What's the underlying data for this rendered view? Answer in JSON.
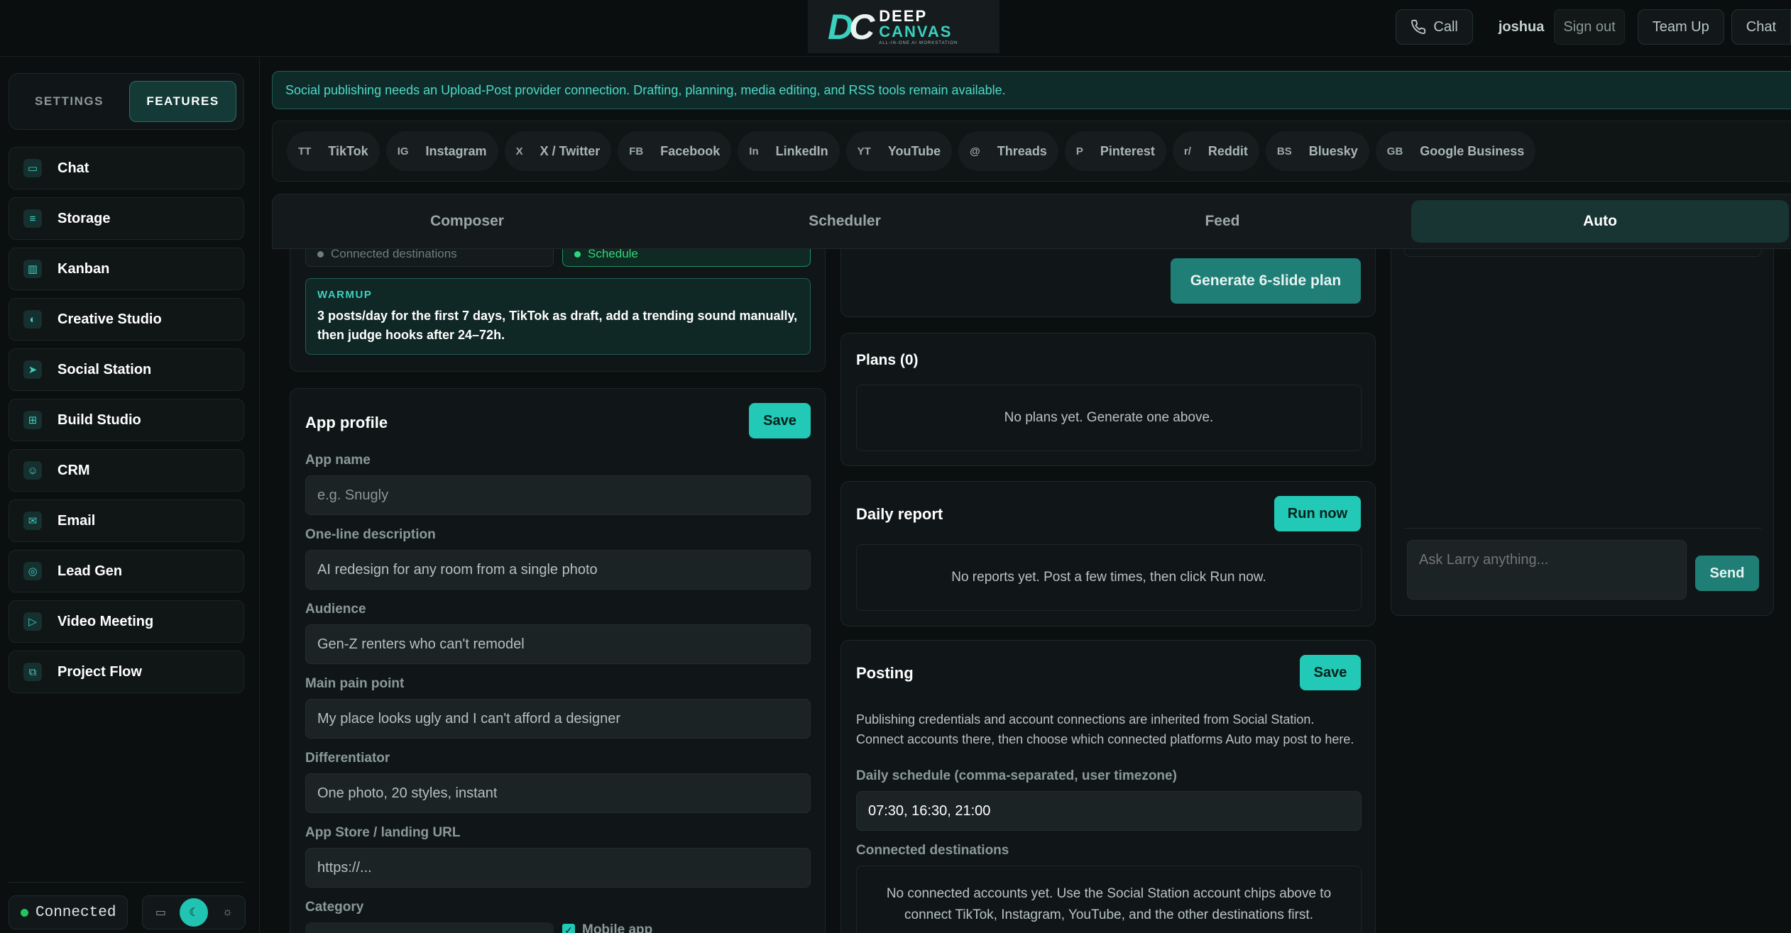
{
  "header": {
    "logo_mark": "DC",
    "logo_line1": "DEEP",
    "logo_line2": "CANVAS",
    "logo_tagline": "ALL-IN-ONE AI WORKSTATION",
    "call_label": "Call",
    "username": "joshua",
    "signout_label": "Sign out",
    "teamup_label": "Team Up",
    "chat_label": "Chat"
  },
  "sidebar": {
    "tabs": [
      "SETTINGS",
      "FEATURES"
    ],
    "active_tab": "FEATURES",
    "items": [
      {
        "label": "Chat",
        "icon": "chat-icon"
      },
      {
        "label": "Storage",
        "icon": "storage-icon"
      },
      {
        "label": "Kanban",
        "icon": "kanban-icon"
      },
      {
        "label": "Creative Studio",
        "icon": "palette-icon"
      },
      {
        "label": "Social Station",
        "icon": "send-icon"
      },
      {
        "label": "Build Studio",
        "icon": "grid-icon"
      },
      {
        "label": "CRM",
        "icon": "users-icon"
      },
      {
        "label": "Email",
        "icon": "mail-icon"
      },
      {
        "label": "Lead Gen",
        "icon": "target-icon"
      },
      {
        "label": "Video Meeting",
        "icon": "video-icon"
      },
      {
        "label": "Project Flow",
        "icon": "flow-icon"
      }
    ],
    "status": "Connected"
  },
  "banner": "Social publishing needs an Upload-Post provider connection. Drafting, planning, media editing, and RSS tools remain available.",
  "platforms": [
    {
      "code": "TT",
      "name": "TikTok"
    },
    {
      "code": "IG",
      "name": "Instagram"
    },
    {
      "code": "X",
      "name": "X / Twitter"
    },
    {
      "code": "FB",
      "name": "Facebook"
    },
    {
      "code": "In",
      "name": "LinkedIn"
    },
    {
      "code": "YT",
      "name": "YouTube"
    },
    {
      "code": "@",
      "name": "Threads"
    },
    {
      "code": "P",
      "name": "Pinterest"
    },
    {
      "code": "r/",
      "name": "Reddit"
    },
    {
      "code": "BS",
      "name": "Bluesky"
    },
    {
      "code": "GB",
      "name": "Google Business"
    }
  ],
  "tabs": [
    "Composer",
    "Scheduler",
    "Feed",
    "Auto"
  ],
  "active_tab": "Auto",
  "col1": {
    "cut_left": "Connected destinations",
    "cut_right": "Schedule",
    "warmup_label": "WARMUP",
    "warmup_text": "3 posts/day for the first 7 days, TikTok as draft, add a trending sound manually, then judge hooks after 24–72h.",
    "app_profile": {
      "title": "App profile",
      "save_label": "Save",
      "fields": [
        {
          "label": "App name",
          "value": "e.g. Snugly"
        },
        {
          "label": "One-line description",
          "value": "AI redesign for any room from a single photo"
        },
        {
          "label": "Audience",
          "value": "Gen-Z renters who can't remodel"
        },
        {
          "label": "Main pain point",
          "value": "My place looks ugly and I can't afford a designer"
        },
        {
          "label": "Differentiator",
          "value": "One photo, 20 styles, instant"
        },
        {
          "label": "App Store / landing URL",
          "value": "https://..."
        }
      ],
      "category_label": "Category",
      "mobile_app_label": "Mobile app"
    }
  },
  "col2": {
    "generate_label": "Generate 6-slide plan",
    "plans_title": "Plans (0)",
    "plans_empty": "No plans yet. Generate one above.",
    "report_title": "Daily report",
    "run_now_label": "Run now",
    "report_empty": "No reports yet. Post a few times, then click Run now.",
    "posting_title": "Posting",
    "posting_save": "Save",
    "posting_desc": "Publishing credentials and account connections are inherited from Social Station. Connect accounts there, then choose which connected platforms Auto may post to here.",
    "schedule_label": "Daily schedule (comma-separated, user timezone)",
    "schedule_value": "07:30, 16:30, 21:00",
    "destinations_label": "Connected destinations",
    "destinations_empty": "No connected accounts yet. Use the Social Station account chips above to connect TikTok, Instagram, YouTube, and the other destinations first."
  },
  "col3": {
    "ask_placeholder": "Ask Larry anything...",
    "send_label": "Send"
  }
}
